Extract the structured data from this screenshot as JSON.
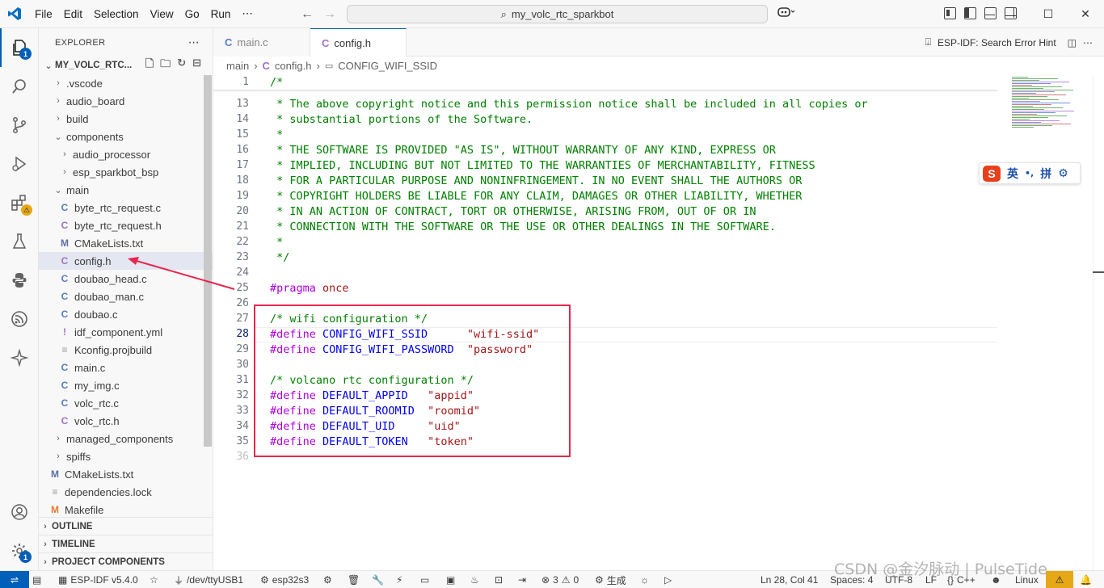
{
  "window": {
    "menu": [
      "File",
      "Edit",
      "Selection",
      "View",
      "Go",
      "Run",
      "⋯"
    ],
    "command_center": "my_volc_rtc_sparkbot",
    "copilot_icon": "copilot-icon"
  },
  "activity_bar": {
    "explorer_badge": "1",
    "accounts_badge": "1",
    "icons": [
      "files-icon",
      "search-icon",
      "source-control-icon",
      "run-debug-icon",
      "extensions-icon",
      "testing-icon",
      "python-icon",
      "esp-idf-icon",
      "sparkle-icon",
      "account-icon",
      "settings-gear-icon"
    ]
  },
  "explorer": {
    "title": "EXPLORER",
    "more": "⋯",
    "root": "MY_VOLC_RTC...",
    "tree": [
      {
        "label": ".vscode",
        "kind": "folder",
        "open": false,
        "depth": 1
      },
      {
        "label": "audio_board",
        "kind": "folder",
        "open": false,
        "depth": 1
      },
      {
        "label": "build",
        "kind": "folder",
        "open": false,
        "depth": 1
      },
      {
        "label": "components",
        "kind": "folder",
        "open": true,
        "depth": 1
      },
      {
        "label": "audio_processor",
        "kind": "folder",
        "open": false,
        "depth": 2
      },
      {
        "label": "esp_sparkbot_bsp",
        "kind": "folder",
        "open": false,
        "depth": 2
      },
      {
        "label": "main",
        "kind": "folder",
        "open": true,
        "depth": 1
      },
      {
        "label": "byte_rtc_request.c",
        "kind": "c",
        "depth": 2
      },
      {
        "label": "byte_rtc_request.h",
        "kind": "h",
        "depth": 2
      },
      {
        "label": "CMakeLists.txt",
        "kind": "cmake",
        "depth": 2
      },
      {
        "label": "config.h",
        "kind": "h",
        "depth": 2,
        "selected": true
      },
      {
        "label": "doubao_head.c",
        "kind": "c",
        "depth": 2
      },
      {
        "label": "doubao_man.c",
        "kind": "c",
        "depth": 2
      },
      {
        "label": "doubao.c",
        "kind": "c",
        "depth": 2
      },
      {
        "label": "idf_component.yml",
        "kind": "yml",
        "depth": 2
      },
      {
        "label": "Kconfig.projbuild",
        "kind": "lines",
        "depth": 2
      },
      {
        "label": "main.c",
        "kind": "c",
        "depth": 2
      },
      {
        "label": "my_img.c",
        "kind": "c",
        "depth": 2
      },
      {
        "label": "volc_rtc.c",
        "kind": "c",
        "depth": 2
      },
      {
        "label": "volc_rtc.h",
        "kind": "h",
        "depth": 2
      },
      {
        "label": "managed_components",
        "kind": "folder",
        "open": false,
        "depth": 1
      },
      {
        "label": "spiffs",
        "kind": "folder",
        "open": false,
        "depth": 1
      },
      {
        "label": "CMakeLists.txt",
        "kind": "cmake",
        "depth": 1
      },
      {
        "label": "dependencies.lock",
        "kind": "lines",
        "depth": 1
      },
      {
        "label": "Makefile",
        "kind": "make",
        "depth": 1
      }
    ],
    "sections": [
      "OUTLINE",
      "TIMELINE",
      "PROJECT COMPONENTS"
    ]
  },
  "tabs": [
    {
      "label": "main.c",
      "active": false,
      "icon": "C"
    },
    {
      "label": "config.h",
      "active": true,
      "icon": "C",
      "modified": true
    }
  ],
  "tab_actions": {
    "error_hint": "ESP-IDF: Search Error Hint"
  },
  "breadcrumb": {
    "folder": "main",
    "file": "config.h",
    "symbol": "CONFIG_WIFI_SSID"
  },
  "editor": {
    "sticky": {
      "num": "1",
      "text": "/*"
    },
    "lines": [
      {
        "num": "13",
        "parts": [
          {
            "t": " * The above copyright notice and this permission notice shall be included in all copies or",
            "c": "cm"
          }
        ]
      },
      {
        "num": "14",
        "parts": [
          {
            "t": " * substantial portions of the Software.",
            "c": "cm"
          }
        ]
      },
      {
        "num": "15",
        "parts": [
          {
            "t": " *",
            "c": "cm"
          }
        ]
      },
      {
        "num": "16",
        "parts": [
          {
            "t": " * THE SOFTWARE IS PROVIDED \"AS IS\", WITHOUT WARRANTY OF ANY KIND, EXPRESS OR",
            "c": "cm"
          }
        ]
      },
      {
        "num": "17",
        "parts": [
          {
            "t": " * IMPLIED, INCLUDING BUT NOT LIMITED TO THE WARRANTIES OF MERCHANTABILITY, FITNESS",
            "c": "cm"
          }
        ]
      },
      {
        "num": "18",
        "parts": [
          {
            "t": " * FOR A PARTICULAR PURPOSE AND NONINFRINGEMENT. IN NO EVENT SHALL THE AUTHORS OR",
            "c": "cm"
          }
        ]
      },
      {
        "num": "19",
        "parts": [
          {
            "t": " * COPYRIGHT HOLDERS BE LIABLE FOR ANY CLAIM, DAMAGES OR OTHER LIABILITY, WHETHER",
            "c": "cm"
          }
        ]
      },
      {
        "num": "20",
        "parts": [
          {
            "t": " * IN AN ACTION OF CONTRACT, TORT OR OTHERWISE, ARISING FROM, OUT OF OR IN",
            "c": "cm"
          }
        ]
      },
      {
        "num": "21",
        "parts": [
          {
            "t": " * CONNECTION WITH THE SOFTWARE OR THE USE OR OTHER DEALINGS IN THE SOFTWARE.",
            "c": "cm"
          }
        ]
      },
      {
        "num": "22",
        "parts": [
          {
            "t": " *",
            "c": "cm"
          }
        ]
      },
      {
        "num": "23",
        "parts": [
          {
            "t": " */",
            "c": "cm"
          }
        ]
      },
      {
        "num": "24",
        "parts": []
      },
      {
        "num": "25",
        "parts": [
          {
            "t": "#pragma",
            "c": "pp"
          },
          {
            "t": " ",
            "c": "plain"
          },
          {
            "t": "once",
            "c": "str"
          }
        ]
      },
      {
        "num": "26",
        "parts": []
      },
      {
        "num": "27",
        "parts": [
          {
            "t": "/* wifi configuration */",
            "c": "cm"
          }
        ]
      },
      {
        "num": "28",
        "parts": [
          {
            "t": "#define",
            "c": "pp"
          },
          {
            "t": " ",
            "c": "plain"
          },
          {
            "t": "CONFIG_WIFI_SSID",
            "c": "id"
          },
          {
            "t": "      ",
            "c": "plain"
          },
          {
            "t": "\"wifi-ssid\"",
            "c": "str"
          }
        ],
        "current": true
      },
      {
        "num": "29",
        "parts": [
          {
            "t": "#define",
            "c": "pp"
          },
          {
            "t": " ",
            "c": "plain"
          },
          {
            "t": "CONFIG_WIFI_PASSWORD",
            "c": "id"
          },
          {
            "t": "  ",
            "c": "plain"
          },
          {
            "t": "\"password\"",
            "c": "str"
          }
        ]
      },
      {
        "num": "30",
        "parts": []
      },
      {
        "num": "31",
        "parts": [
          {
            "t": "/* volcano rtc configuration */",
            "c": "cm"
          }
        ]
      },
      {
        "num": "32",
        "parts": [
          {
            "t": "#define",
            "c": "pp"
          },
          {
            "t": " ",
            "c": "plain"
          },
          {
            "t": "DEFAULT_APPID",
            "c": "id"
          },
          {
            "t": "   ",
            "c": "plain"
          },
          {
            "t": "\"appid\"",
            "c": "str"
          }
        ]
      },
      {
        "num": "33",
        "parts": [
          {
            "t": "#define",
            "c": "pp"
          },
          {
            "t": " ",
            "c": "plain"
          },
          {
            "t": "DEFAULT_ROOMID",
            "c": "id"
          },
          {
            "t": "  ",
            "c": "plain"
          },
          {
            "t": "\"roomid\"",
            "c": "str"
          }
        ]
      },
      {
        "num": "34",
        "parts": [
          {
            "t": "#define",
            "c": "pp"
          },
          {
            "t": " ",
            "c": "plain"
          },
          {
            "t": "DEFAULT_UID",
            "c": "id"
          },
          {
            "t": "     ",
            "c": "plain"
          },
          {
            "t": "\"uid\"",
            "c": "str"
          }
        ]
      },
      {
        "num": "35",
        "parts": [
          {
            "t": "#define",
            "c": "pp"
          },
          {
            "t": " ",
            "c": "plain"
          },
          {
            "t": "DEFAULT_TOKEN",
            "c": "id"
          },
          {
            "t": "   ",
            "c": "plain"
          },
          {
            "t": "\"token\"",
            "c": "str"
          }
        ]
      },
      {
        "num": "36",
        "parts": []
      }
    ]
  },
  "ime": {
    "lang": "英",
    "punct": "•,",
    "pinyin": "拼"
  },
  "status": {
    "idf_version": "ESP-IDF v5.4.0",
    "port": "/dev/ttyUSB1",
    "target": "esp32s3",
    "errors": "3",
    "warnings": "0",
    "build": "生成",
    "position": "Ln 28, Col 41",
    "spaces": "Spaces: 4",
    "encoding": "UTF-8",
    "eol": "LF",
    "language": "C++",
    "platform": "Linux"
  },
  "watermark": "CSDN @金汐脉动 | PulseTide",
  "colors": {
    "accent": "#005fb8",
    "annotation": "#e8264e",
    "comment": "#008000",
    "keyword": "#af00db",
    "macro": "#0000ff",
    "string": "#a31515"
  }
}
